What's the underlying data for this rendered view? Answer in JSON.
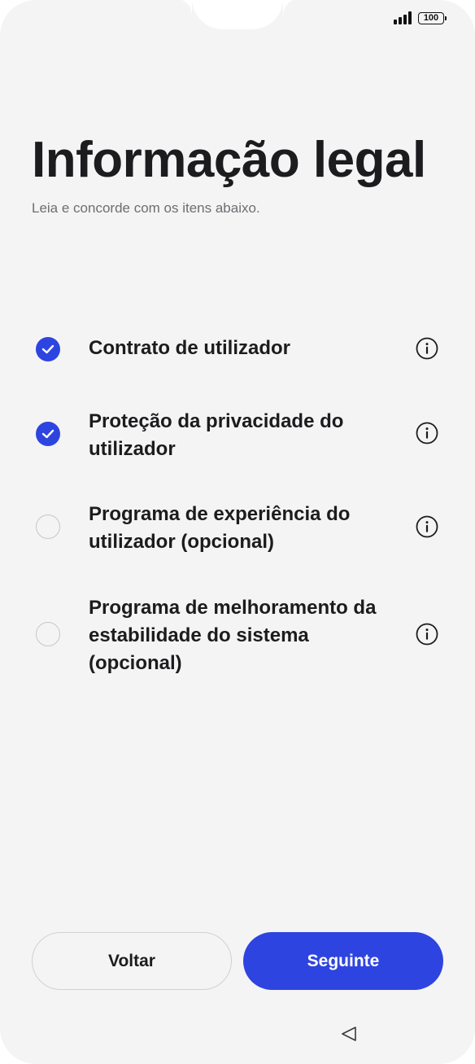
{
  "status_bar": {
    "battery": "100"
  },
  "header": {
    "title": "Informação legal",
    "subtitle": "Leia e concorde com os itens abaixo."
  },
  "items": [
    {
      "label": "Contrato de utilizador",
      "checked": true
    },
    {
      "label": "Proteção da privacidade do utilizador",
      "checked": true
    },
    {
      "label": "Programa de experiência do utilizador (opcional)",
      "checked": false
    },
    {
      "label": "Programa de melhoramento da estabilidade do sistema (opcional)",
      "checked": false
    }
  ],
  "buttons": {
    "back_label": "Voltar",
    "next_label": "Seguinte"
  },
  "colors": {
    "accent": "#2e44e0",
    "background": "#f4f4f5",
    "text": "#1c1c1e"
  },
  "icons": {
    "check": "checkmark-icon",
    "info": "info-icon",
    "nav_back": "triangle-back-icon",
    "signal": "signal-icon",
    "battery": "battery-icon"
  }
}
